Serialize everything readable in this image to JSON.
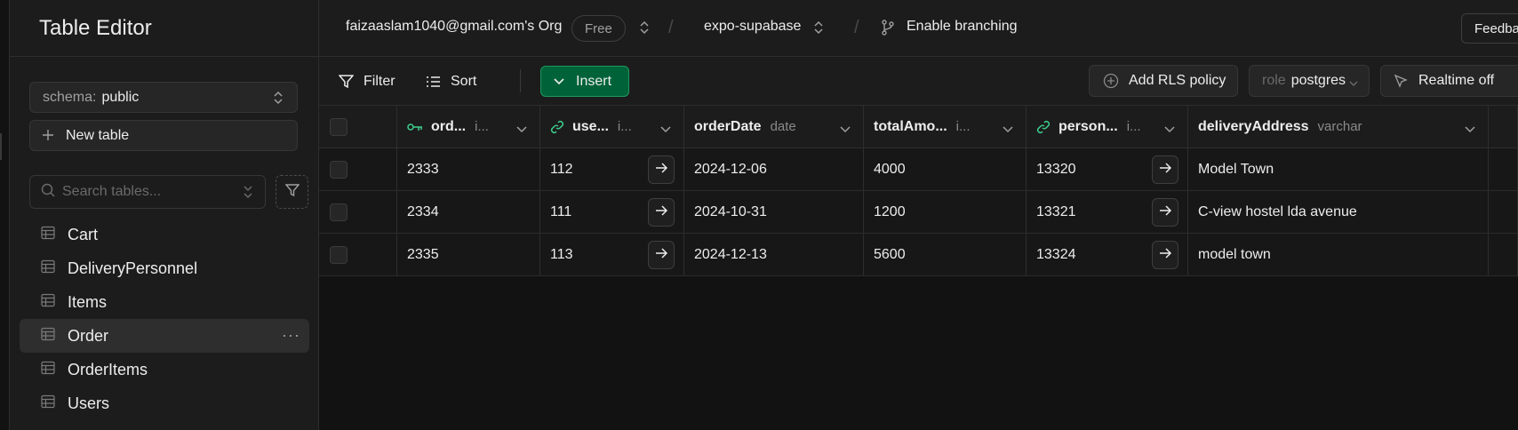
{
  "sidebar": {
    "title": "Table Editor",
    "schema": {
      "label": "schema:",
      "value": "public"
    },
    "new_table_label": "New table",
    "search": {
      "placeholder": "Search tables..."
    },
    "tables": [
      {
        "label": "Cart",
        "active": false
      },
      {
        "label": "DeliveryPersonnel",
        "active": false
      },
      {
        "label": "Items",
        "active": false
      },
      {
        "label": "Order",
        "active": true
      },
      {
        "label": "OrderItems",
        "active": false
      },
      {
        "label": "Users",
        "active": false
      }
    ],
    "more_glyph": "···"
  },
  "topbar": {
    "org": "faizaaslam1040@gmail.com's Org",
    "plan_badge": "Free",
    "project": "expo-supabase",
    "branching": "Enable branching",
    "feedback": "Feedback",
    "separator": "/"
  },
  "toolbar": {
    "filter": "Filter",
    "sort": "Sort",
    "insert": "Insert",
    "rls": "Add RLS policy",
    "role": {
      "label": "role",
      "value": "postgres"
    },
    "realtime": "Realtime off"
  },
  "grid": {
    "columns": [
      {
        "name": "ord...",
        "type": "i...",
        "icon": "key-icon"
      },
      {
        "name": "use...",
        "type": "i...",
        "icon": "link-icon"
      },
      {
        "name": "orderDate",
        "type": "date",
        "icon": ""
      },
      {
        "name": "totalAmo...",
        "type": "i...",
        "icon": ""
      },
      {
        "name": "person...",
        "type": "i...",
        "icon": "link-icon"
      },
      {
        "name": "deliveryAddress",
        "type": "varchar",
        "icon": ""
      }
    ],
    "rows": [
      [
        "2333",
        "112",
        "2024-12-06",
        "4000",
        "13320",
        "Model Town"
      ],
      [
        "2334",
        "111",
        "2024-10-31",
        "1200",
        "13321",
        "C-view hostel lda avenue"
      ],
      [
        "2335",
        "113",
        "2024-12-13",
        "5600",
        "13324",
        "model town"
      ]
    ]
  },
  "colors": {
    "accent_green": "#3ecf8e",
    "insert_bg": "#006239",
    "background": "#1c1c1c",
    "grid_bg": "#121212"
  }
}
